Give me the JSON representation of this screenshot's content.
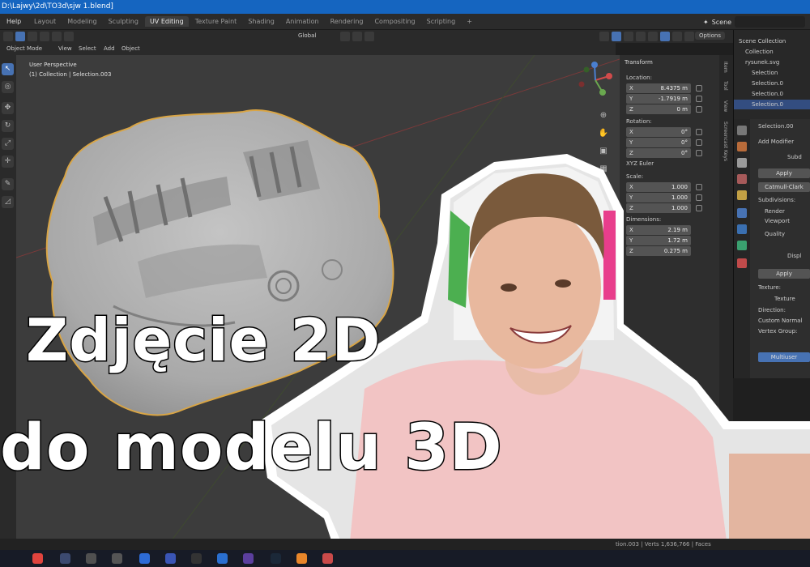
{
  "window": {
    "title": "D:\\Lajwy\\2d\\TO3d\\sjw 1.blend]"
  },
  "menu": {
    "help": "Help"
  },
  "workspace_tabs": [
    "Layout",
    "Modeling",
    "Sculpting",
    "UV Editing",
    "Texture Paint",
    "Shading",
    "Animation",
    "Rendering",
    "Compositing",
    "Scripting",
    "+"
  ],
  "active_tab_index": 3,
  "scene": {
    "label": "Scene"
  },
  "viewport_header": {
    "orientation": "Global",
    "options": "Options",
    "mode": "Object Mode",
    "menus": [
      "View",
      "Select",
      "Add",
      "Object"
    ]
  },
  "viewport": {
    "perspective": "User Perspective",
    "collection": "(1) Collection | Selection.003"
  },
  "npanel": {
    "header": "Transform",
    "location_label": "Location:",
    "location": [
      {
        "axis": "X",
        "value": "8.4375 m"
      },
      {
        "axis": "Y",
        "value": "-1.7919 m"
      },
      {
        "axis": "Z",
        "value": "0 m"
      }
    ],
    "rotation_label": "Rotation:",
    "rotation": [
      {
        "axis": "X",
        "value": "0°"
      },
      {
        "axis": "Y",
        "value": "0°"
      },
      {
        "axis": "Z",
        "value": "0°"
      }
    ],
    "rotation_mode": "XYZ Euler",
    "scale_label": "Scale:",
    "scale": [
      {
        "axis": "X",
        "value": "1.000"
      },
      {
        "axis": "Y",
        "value": "1.000"
      },
      {
        "axis": "Z",
        "value": "1.000"
      }
    ],
    "dimensions_label": "Dimensions:",
    "dimensions": [
      {
        "axis": "X",
        "value": "2.19 m"
      },
      {
        "axis": "Y",
        "value": "1.72 m"
      },
      {
        "axis": "Z",
        "value": "0.275 m"
      }
    ],
    "side_tabs": [
      "Item",
      "Tool",
      "View",
      "Screencast Keys"
    ]
  },
  "outliner": {
    "items": [
      {
        "label": "Scene Collection",
        "selected": false
      },
      {
        "label": "Collection",
        "selected": false
      },
      {
        "label": "rysunek.svg",
        "selected": false
      },
      {
        "label": "Selection",
        "selected": false
      },
      {
        "label": "Selection.0",
        "selected": false
      },
      {
        "label": "Selection.0",
        "selected": false
      },
      {
        "label": "Selection.0",
        "selected": true
      }
    ]
  },
  "properties": {
    "object": "Selection.00",
    "add_modifier": "Add Modifier",
    "subd_name": "Subd",
    "apply": "Apply",
    "catmull": "Catmull-Clark",
    "subdivisions": "Subdivisions:",
    "render": "Render",
    "viewport": "Viewport",
    "quality": "Quality",
    "displ_name": "Displ",
    "apply2": "Apply",
    "texture_label": "Texture:",
    "texture": "Texture",
    "direction": "Direction:",
    "direction_value": "Custom Normal",
    "vertex_group": "Vertex Group:",
    "multiuser": "Multiuser"
  },
  "status": {
    "text": "tion.003 | Verts 1,636,766 | Faces"
  },
  "headline": {
    "line1": "Zdjęcie 2D",
    "line2": "do modelu 3D"
  },
  "colors": {
    "accent": "#4772b3",
    "titlebar": "#1565c0",
    "shirt": "#f2c4c4",
    "relief": "#b5b5b5"
  }
}
